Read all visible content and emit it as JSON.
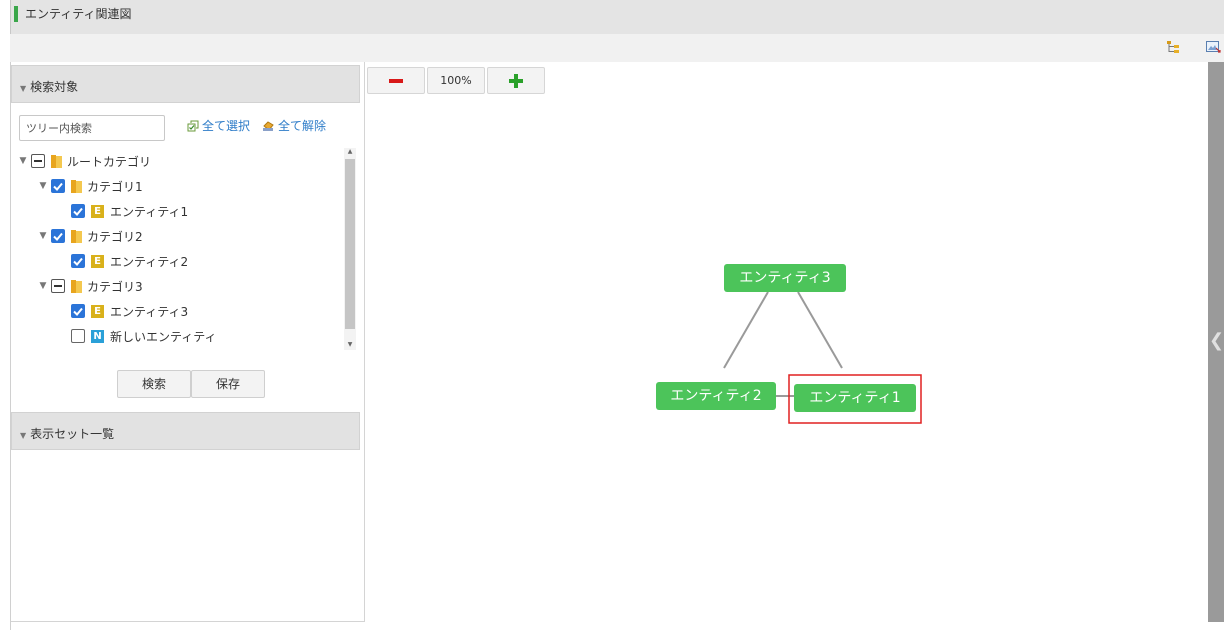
{
  "app": {
    "title": "エンティティ関連図"
  },
  "search_panel": {
    "header": "検索対象",
    "tree_search_placeholder": "ツリー内検索",
    "select_all_label": "全て選択",
    "deselect_all_label": "全て解除",
    "tree": [
      {
        "label": "ルートカテゴリ",
        "type": "folder",
        "state": "partial",
        "expanded": true,
        "level": 0
      },
      {
        "label": "カテゴリ1",
        "type": "folder",
        "state": "checked",
        "expanded": true,
        "level": 1
      },
      {
        "label": "エンティティ1",
        "type": "entity",
        "badge": "E",
        "state": "checked",
        "level": 2
      },
      {
        "label": "カテゴリ2",
        "type": "folder",
        "state": "checked",
        "expanded": true,
        "level": 1
      },
      {
        "label": "エンティティ2",
        "type": "entity",
        "badge": "E",
        "state": "checked",
        "level": 2
      },
      {
        "label": "カテゴリ3",
        "type": "folder",
        "state": "partial",
        "expanded": true,
        "level": 1
      },
      {
        "label": "エンティティ3",
        "type": "entity",
        "badge": "E",
        "state": "checked",
        "level": 2
      },
      {
        "label": "新しいエンティティ",
        "type": "entity",
        "badge": "N",
        "state": "unchecked",
        "level": 2
      }
    ],
    "search_button": "検索",
    "save_button": "保存"
  },
  "display_sets": {
    "header": "表示セット一覧"
  },
  "graph": {
    "zoom_out_icon": "minus-icon",
    "zoom_level": "100%",
    "zoom_in_icon": "plus-icon",
    "nodes": [
      {
        "id": "e3",
        "label": "エンティティ3"
      },
      {
        "id": "e2",
        "label": "エンティティ2"
      },
      {
        "id": "e1",
        "label": "エンティティ1",
        "highlighted": true
      }
    ],
    "edges": [
      [
        "e3",
        "e2"
      ],
      [
        "e3",
        "e1"
      ],
      [
        "e2",
        "e1"
      ]
    ]
  },
  "colors": {
    "node": "#4cc45a",
    "highlight_border": "#e02020",
    "link": "#2e7cc8",
    "checkbox": "#2b74d8"
  }
}
